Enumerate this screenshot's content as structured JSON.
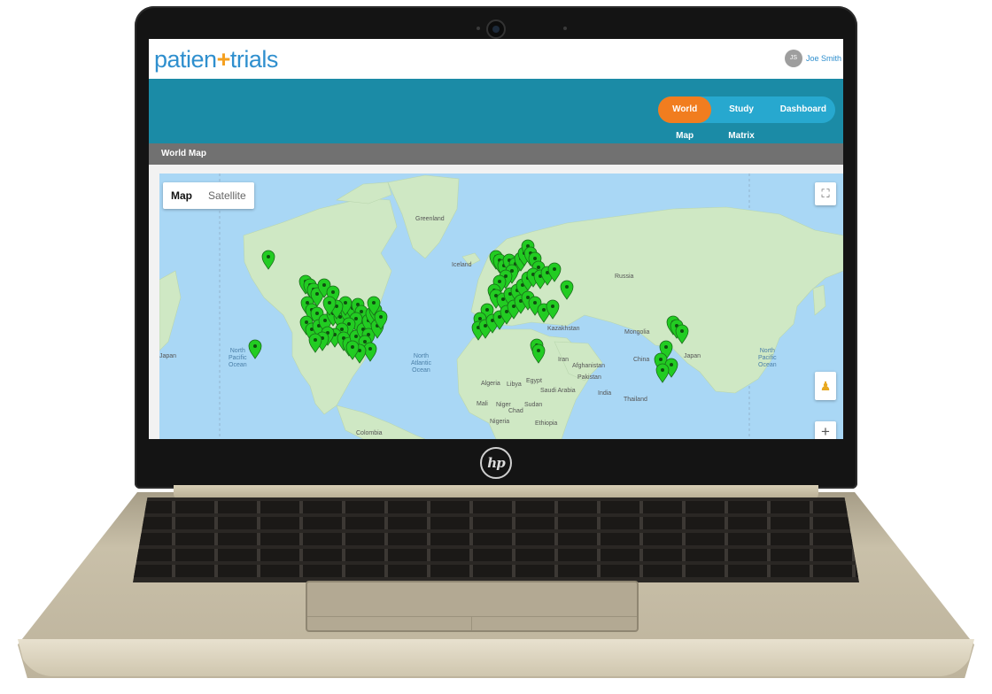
{
  "app": {
    "brand_prefix": "patien",
    "brand_plus": "+",
    "brand_suffix": "trials",
    "user": {
      "initials": "JS",
      "name": "Joe Smith"
    }
  },
  "nav": {
    "items": [
      {
        "label": "World Map",
        "active": true
      },
      {
        "label": "Study Matrix",
        "active": false
      },
      {
        "label": "Dashboard",
        "active": false
      }
    ]
  },
  "section": {
    "title": "World Map"
  },
  "map": {
    "type_options": [
      "Map",
      "Satellite"
    ],
    "selected_type": "Map",
    "zoom_in_label": "+",
    "marker_color": "#22cc22",
    "labels": {
      "greenland": "Greenland",
      "iceland": "Iceland",
      "russia": "Russia",
      "kazakhstan": "Kazakhstan",
      "mongolia": "Mongolia",
      "china": "China",
      "japan_left": "Japan",
      "japan_right": "Japan",
      "north_pacific_left": "North\nPacific\nOcean",
      "north_atlantic": "North\nAtlantic\nOcean",
      "north_pacific_right": "North\nPacific\nOcean",
      "algeria": "Algeria",
      "libya": "Libya",
      "egypt": "Egypt",
      "saudi_arabia": "Saudi Arabia",
      "iran": "Iran",
      "afghanistan": "Afghanistan",
      "pakistan": "Pakistan",
      "india": "India",
      "thailand": "Thailand",
      "mali": "Mali",
      "niger": "Niger",
      "chad": "Chad",
      "sudan": "Sudan",
      "nigeria": "Nigeria",
      "ethiopia": "Ethiopia",
      "colombia": "Colombia"
    }
  },
  "device": {
    "logo": "hp"
  },
  "colors": {
    "brand_blue": "#2f8fce",
    "brand_orange": "#f5a020",
    "banner": "#1b8ba6",
    "nav_pill": "#27a8cf",
    "nav_active": "#f17d1f",
    "section_bar": "#717171",
    "water": "#a9d7f5",
    "land": "#cfe8c4"
  }
}
